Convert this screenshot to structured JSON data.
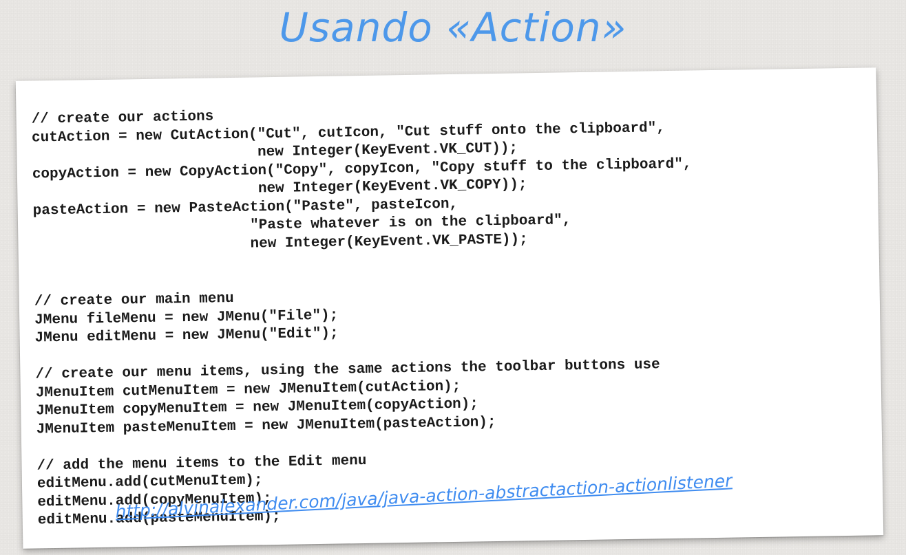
{
  "slide": {
    "subtitle": "Usando «Action»",
    "link": "http://alvinalexander.com/java/java-action-abstractaction-actionlistener"
  },
  "code_lines": [
    "// create our actions",
    "cutAction = new CutAction(\"Cut\", cutIcon, \"Cut stuff onto the clipboard\",",
    "                          new Integer(KeyEvent.VK_CUT));",
    "copyAction = new CopyAction(\"Copy\", copyIcon, \"Copy stuff to the clipboard\",",
    "                          new Integer(KeyEvent.VK_COPY));",
    "pasteAction = new PasteAction(\"Paste\", pasteIcon,",
    "                         \"Paste whatever is on the clipboard\",",
    "                         new Integer(KeyEvent.VK_PASTE));",
    "",
    "",
    "// create our main menu",
    "JMenu fileMenu = new JMenu(\"File\");",
    "JMenu editMenu = new JMenu(\"Edit\");",
    "",
    "// create our menu items, using the same actions the toolbar buttons use",
    "JMenuItem cutMenuItem = new JMenuItem(cutAction);",
    "JMenuItem copyMenuItem = new JMenuItem(copyAction);",
    "JMenuItem pasteMenuItem = new JMenuItem(pasteAction);",
    "",
    "// add the menu items to the Edit menu",
    "editMenu.add(cutMenuItem);",
    "editMenu.add(copyMenuItem);",
    "editMenu.add(pasteMenuItem);"
  ]
}
